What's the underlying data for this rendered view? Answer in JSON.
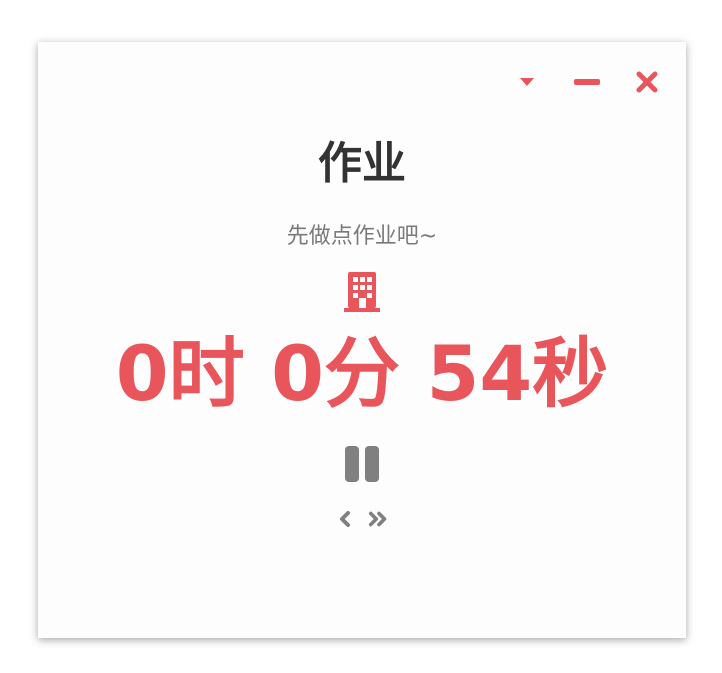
{
  "window": {
    "controls": [
      "chevron-down-icon",
      "minimize-icon",
      "close-icon"
    ]
  },
  "task": {
    "title": "作业",
    "subtitle": "先做点作业吧~",
    "icon": "building-icon"
  },
  "timer": {
    "display": "0时 0分 54秒",
    "hours": 0,
    "minutes": 0,
    "seconds": 54
  },
  "controls": {
    "pause_icon": "pause-icon",
    "prev_icon": "chevron-left-icon",
    "skip_icon": "double-chevron-right-icon"
  },
  "colors": {
    "accent": "#e8555b",
    "title": "#333333",
    "muted": "#7a7a7a",
    "icon_gray": "#808080"
  }
}
